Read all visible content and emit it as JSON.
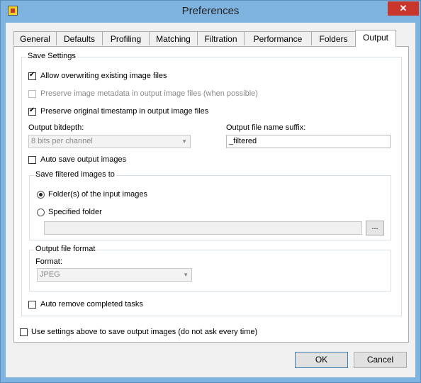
{
  "window": {
    "title": "Preferences",
    "close_glyph": "✕"
  },
  "tabs": [
    {
      "label": "General"
    },
    {
      "label": "Defaults"
    },
    {
      "label": "Profiling"
    },
    {
      "label": "Matching"
    },
    {
      "label": "Filtration"
    },
    {
      "label": "Performance"
    },
    {
      "label": "Folders"
    },
    {
      "label": "Output",
      "active": true
    }
  ],
  "save_settings": {
    "legend": "Save Settings",
    "allow_overwrite": {
      "label": "Allow overwriting existing image files",
      "checked": true
    },
    "preserve_metadata": {
      "label": "Preserve image metadata in output image files (when possible)",
      "checked": false,
      "enabled": false
    },
    "preserve_timestamp": {
      "label": "Preserve original timestamp in output image files",
      "checked": true
    },
    "bitdepth": {
      "label": "Output bitdepth:",
      "value": "8 bits per channel",
      "enabled": false
    },
    "suffix": {
      "label": "Output file name suffix:",
      "value": "_filtered"
    },
    "auto_save": {
      "label": "Auto save output images",
      "checked": false
    },
    "save_to": {
      "legend": "Save filtered images to",
      "input_folders": {
        "label": "Folder(s) of the input images",
        "checked": true
      },
      "specified_folder": {
        "label": "Specified folder",
        "checked": false
      },
      "folder_path": "",
      "browse_label": "..."
    },
    "file_format": {
      "legend": "Output file format",
      "format_label": "Format:",
      "format_value": "JPEG"
    },
    "auto_remove": {
      "label": "Auto remove completed tasks",
      "checked": false
    }
  },
  "use_settings": {
    "label": "Use settings above to save output images (do not ask every time)",
    "checked": false
  },
  "buttons": {
    "ok": "OK",
    "cancel": "Cancel"
  },
  "colors": {
    "titlebar": "#7fb3df",
    "close": "#c7352b",
    "dialog_bg": "#f0f0f0"
  }
}
